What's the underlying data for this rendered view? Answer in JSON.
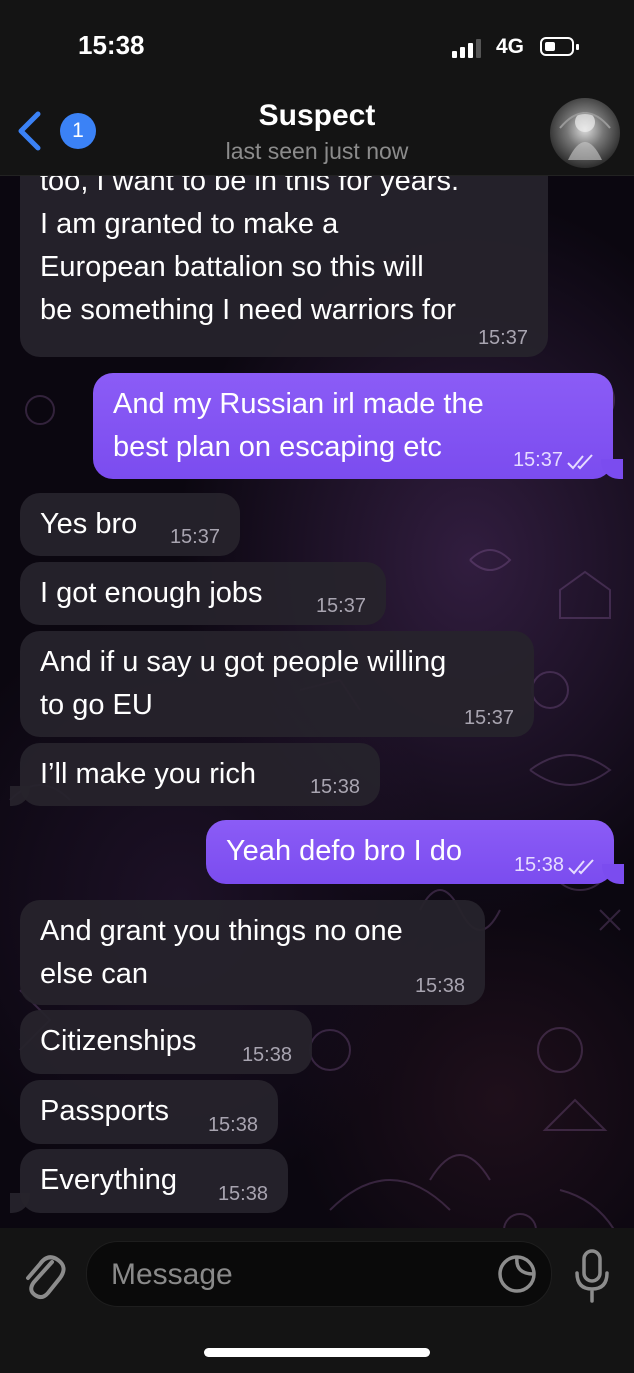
{
  "status_bar": {
    "time": "15:38",
    "network": "4G",
    "signal_bars": 3
  },
  "header": {
    "back_count": "1",
    "contact_name": "Suspect",
    "contact_status": "last seen just now"
  },
  "messages": [
    {
      "direction": "in",
      "text": "too, I want to be in this for years.\nI am granted to make a\nEuropean battalion so this will\nbe something I need warriors for",
      "time": "15:37"
    },
    {
      "direction": "out",
      "text": "And my Russian irl made the\nbest plan on escaping etc",
      "time": "15:37",
      "status": "read"
    },
    {
      "direction": "in",
      "text": "Yes bro",
      "time": "15:37"
    },
    {
      "direction": "in",
      "text": "I got enough jobs",
      "time": "15:37"
    },
    {
      "direction": "in",
      "text": "And if u say u got people willing\nto go EU",
      "time": "15:37"
    },
    {
      "direction": "in",
      "text": "I’ll make you rich",
      "time": "15:38"
    },
    {
      "direction": "out",
      "text": "Yeah defo bro I do",
      "time": "15:38",
      "status": "read"
    },
    {
      "direction": "in",
      "text": "And grant you things no one\nelse can",
      "time": "15:38"
    },
    {
      "direction": "in",
      "text": "Citizenships",
      "time": "15:38"
    },
    {
      "direction": "in",
      "text": "Passports",
      "time": "15:38"
    },
    {
      "direction": "in",
      "text": "Everything",
      "time": "15:38"
    }
  ],
  "composer": {
    "placeholder": "Message"
  },
  "colors": {
    "accent": "#3b82f6",
    "outgoing_bubble": "#8b5cf6",
    "incoming_bubble": "#26232c"
  },
  "icons": [
    "back-chevron-icon",
    "attach-paperclip-icon",
    "sticker-icon",
    "microphone-icon",
    "double-check-icon"
  ]
}
